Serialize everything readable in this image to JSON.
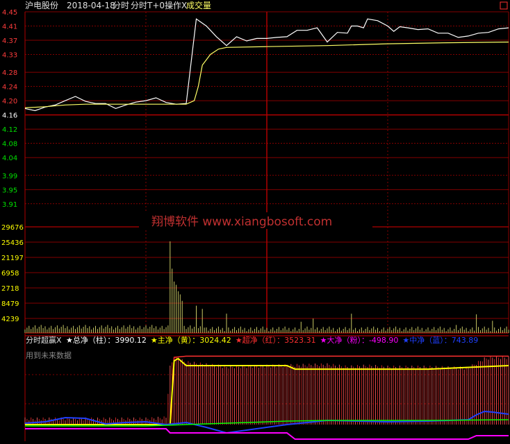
{
  "header": {
    "stock_name": "沪电股份",
    "date": "2018-04-18",
    "mode": "分时",
    "indicator": "分时T+0操作X",
    "volume_label": "成交量",
    "close_box": "□"
  },
  "watermark": "翔博软件 www.xiangbosoft.com",
  "colors": {
    "bg": "#000000",
    "grid": "#b00000",
    "price_line": "#ffffff",
    "avg_line": "#ffff66",
    "volume_bar": "#c8c864",
    "up_label": "#ff3c3c",
    "down_label": "#00e000",
    "red": "#ff3030",
    "yellow": "#ffff00",
    "magenta": "#ff00ff",
    "blue": "#2040ff",
    "green": "#00ff00"
  },
  "indicator_legend": {
    "name": "分时超赢X",
    "items": [
      {
        "label": "★总净（柱）",
        "value": "3990.12",
        "color": "#ffffff"
      },
      {
        "label": "★主净（黄）",
        "value": "3024.42",
        "color": "#ffff00"
      },
      {
        "label": "★超净（红）",
        "value": "3523.31",
        "color": "#ff3030"
      },
      {
        "label": "★大净（粉）",
        "value": "-498.90",
        "color": "#ff00ff"
      },
      {
        "label": "★中净（蓝）",
        "value": "743.89",
        "color": "#2040ff"
      }
    ],
    "future_note": "用到未来数据"
  },
  "chart_data": [
    {
      "type": "line",
      "ylim": [
        3.89,
        4.45
      ],
      "y_ticks": [
        "4.45",
        "4.41",
        "4.37",
        "4.33",
        "4.28",
        "4.24",
        "4.20",
        "4.16",
        "4.12",
        "4.08",
        "4.04",
        "3.99",
        "3.95",
        "3.91"
      ],
      "y_tick_values": [
        4.45,
        4.41,
        4.37,
        4.33,
        4.28,
        4.24,
        4.2,
        4.16,
        4.12,
        4.08,
        4.04,
        3.99,
        3.95,
        3.91
      ],
      "reference_price": 4.16,
      "n_minutes": 241,
      "series": [
        {
          "key": "price",
          "color": "#ffffff",
          "x": [
            0,
            5,
            10,
            15,
            20,
            25,
            30,
            35,
            40,
            45,
            50,
            55,
            60,
            65,
            70,
            75,
            80,
            85,
            90,
            95,
            100,
            105,
            110,
            115,
            120,
            125,
            130,
            135,
            140,
            145,
            150,
            155,
            160,
            162,
            165,
            168,
            170,
            175,
            180,
            183,
            186,
            190,
            195,
            200,
            205,
            210,
            215,
            220,
            225,
            230,
            235,
            240
          ],
          "values": [
            4.178,
            4.172,
            4.182,
            4.188,
            4.2,
            4.212,
            4.198,
            4.192,
            4.192,
            4.178,
            4.188,
            4.196,
            4.2,
            4.208,
            4.195,
            4.19,
            4.192,
            4.43,
            4.41,
            4.38,
            4.355,
            4.38,
            4.368,
            4.375,
            4.375,
            4.378,
            4.38,
            4.398,
            4.398,
            4.405,
            4.365,
            4.392,
            4.39,
            4.41,
            4.41,
            4.405,
            4.43,
            4.425,
            4.41,
            4.395,
            4.408,
            4.405,
            4.4,
            4.402,
            4.39,
            4.39,
            4.378,
            4.382,
            4.39,
            4.392,
            4.402,
            4.405
          ]
        },
        {
          "key": "average",
          "color": "#ffff66",
          "x": [
            0,
            10,
            20,
            30,
            40,
            50,
            60,
            70,
            80,
            84,
            86,
            88,
            92,
            96,
            100,
            120,
            150,
            180,
            210,
            240
          ],
          "values": [
            4.18,
            4.183,
            4.188,
            4.19,
            4.19,
            4.19,
            4.19,
            4.19,
            4.19,
            4.2,
            4.24,
            4.3,
            4.33,
            4.345,
            4.35,
            4.352,
            4.355,
            4.36,
            4.363,
            4.365
          ]
        }
      ]
    },
    {
      "type": "bar",
      "y_ticks": [
        "29676",
        "25436",
        "21197",
        "6958",
        "2718",
        "8479",
        "4239"
      ],
      "ylim": [
        0,
        33000
      ],
      "bar_color": "#c8c864",
      "peaks": [
        [
          72,
          28500
        ],
        [
          73,
          20000
        ],
        [
          74,
          16000
        ],
        [
          75,
          15000
        ],
        [
          76,
          13000
        ],
        [
          77,
          12000
        ],
        [
          78,
          10000
        ],
        [
          85,
          8500
        ],
        [
          88,
          7500
        ],
        [
          100,
          6000
        ],
        [
          137,
          3500
        ],
        [
          143,
          4500
        ],
        [
          162,
          6000
        ],
        [
          214,
          2500
        ],
        [
          224,
          5800
        ],
        [
          232,
          3800
        ]
      ],
      "note": "minute volumes; remaining bars are low baseline values"
    },
    {
      "type": "bar",
      "ylim": [
        -3000,
        6000
      ],
      "series": [
        {
          "key": "zong_jing",
          "color": "#ff3030",
          "x": [
            0,
            60,
            70,
            72,
            74,
            80,
            90,
            100,
            150,
            160,
            170,
            180,
            200,
            220,
            224,
            228,
            232,
            240
          ],
          "values": [
            600,
            600,
            700,
            5000,
            5800,
            5400,
            5200,
            5000,
            5200,
            5000,
            5100,
            5000,
            5000,
            4900,
            5300,
            5700,
            5800,
            5800
          ]
        },
        {
          "key": "zhu_jing",
          "color": "#ffff00",
          "x": [
            0,
            72,
            74,
            76,
            80,
            86,
            130,
            134,
            150,
            200,
            240
          ],
          "values": [
            0,
            0,
            5400,
            5600,
            5000,
            5000,
            5000,
            4700,
            4700,
            4700,
            5000
          ]
        },
        {
          "key": "chao_jing",
          "color": "#ff3030",
          "x": [
            0,
            72,
            74,
            80,
            240
          ],
          "values": [
            0,
            0,
            5700,
            5800,
            5800
          ]
        }
      ]
    }
  ]
}
